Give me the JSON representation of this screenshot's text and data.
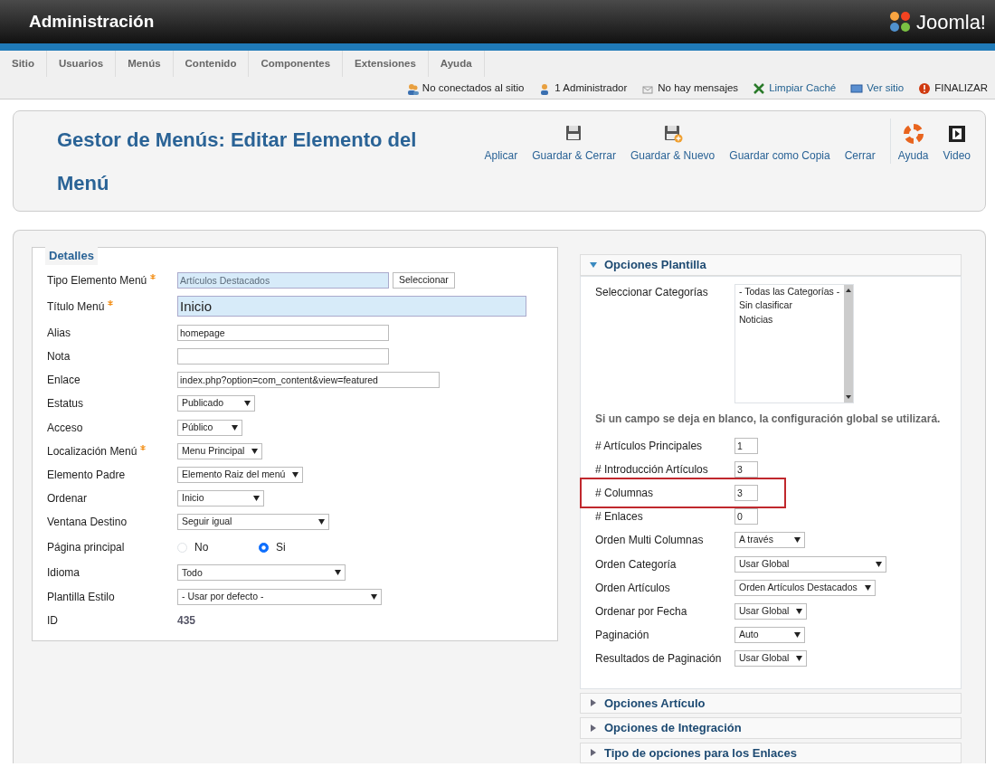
{
  "header": {
    "title": "Administración",
    "logo": "Joomla!"
  },
  "menu": [
    "Sitio",
    "Usuarios",
    "Menús",
    "Contenido",
    "Componentes",
    "Extensiones",
    "Ayuda"
  ],
  "status": [
    {
      "text": "No conectados al sitio",
      "kind": "plain"
    },
    {
      "text": "1 Administrador",
      "kind": "plain"
    },
    {
      "text": "No hay mensajes",
      "kind": "plain"
    },
    {
      "text": "Limpiar Caché",
      "kind": "link"
    },
    {
      "text": "Ver sitio",
      "kind": "link"
    },
    {
      "text": "FINALIZAR",
      "kind": "plain"
    }
  ],
  "toolbar": {
    "title": "Gestor de Menús: Editar Elemento del Menú",
    "buttons": [
      "Aplicar",
      "Guardar & Cerrar",
      "Guardar & Nuevo",
      "Guardar como Copia",
      "Cerrar"
    ],
    "help": [
      "Ayuda",
      "Video"
    ]
  },
  "details": {
    "legend": "Detalles",
    "fields": [
      {
        "kind": "text-button",
        "label": "Tipo Elemento Menú",
        "required": true,
        "value": "Artículos Destacados",
        "button": "Seleccionar"
      },
      {
        "kind": "big-text",
        "label": "Título Menú",
        "required": true,
        "value": "Inicio"
      },
      {
        "kind": "text",
        "label": "Alias",
        "required": false,
        "value": "homepage"
      },
      {
        "kind": "text",
        "label": "Nota",
        "required": false
      },
      {
        "kind": "text",
        "label": "Enlace",
        "required": false,
        "value": "index.php?option=com_content&view=featured"
      },
      {
        "kind": "select",
        "label": "Estatus",
        "required": false,
        "value": "Publicado"
      },
      {
        "kind": "select",
        "label": "Acceso",
        "required": false,
        "value": "Público"
      },
      {
        "kind": "select",
        "label": "Localización Menú",
        "required": true,
        "value": "Menu Principal"
      },
      {
        "kind": "select",
        "label": "Elemento Padre",
        "required": false,
        "value": "Elemento Raiz del menú"
      },
      {
        "kind": "select",
        "label": "Ordenar",
        "required": false,
        "value": "Inicio"
      },
      {
        "kind": "select",
        "label": "Ventana Destino",
        "required": false,
        "value": "Seguir igual"
      },
      {
        "kind": "radio",
        "label": "Página principal",
        "required": false,
        "options": [
          {
            "label": "No",
            "selected": false
          },
          {
            "label": "Si",
            "selected": true
          }
        ]
      },
      {
        "kind": "select",
        "label": "Idioma",
        "required": false,
        "value": "Todo"
      },
      {
        "kind": "select",
        "label": "Plantilla Estilo",
        "required": false,
        "value": "- Usar por defecto -"
      },
      {
        "kind": "static",
        "label": "ID",
        "required": false,
        "value": "435"
      }
    ]
  },
  "panels": [
    {
      "title": "Opciones Plantilla",
      "expanded": true,
      "categories": {
        "label": "Seleccionar Categorías",
        "options": [
          "- Todas las Categorías -",
          "Sin clasificar",
          "Noticias"
        ]
      },
      "note": "Si un campo se deja en blanco, la configuración global se utilizará.",
      "fields": [
        {
          "kind": "number",
          "label": "# Artículos Principales",
          "value": "1",
          "highlighted": false
        },
        {
          "kind": "number",
          "label": "# Introducción Artículos",
          "value": "3",
          "highlighted": false
        },
        {
          "kind": "number",
          "label": "# Columnas",
          "value": "3",
          "highlighted": true
        },
        {
          "kind": "number",
          "label": "# Enlaces",
          "value": "0",
          "highlighted": false
        },
        {
          "kind": "select",
          "label": "Orden Multi Columnas",
          "value": "A través",
          "highlighted": false
        },
        {
          "kind": "select",
          "label": "Orden Categoría",
          "value": "Usar Global",
          "highlighted": false
        },
        {
          "kind": "select",
          "label": "Orden Artículos",
          "value": "Orden Artículos Destacados",
          "highlighted": false
        },
        {
          "kind": "select",
          "label": "Ordenar por Fecha",
          "value": "Usar Global",
          "highlighted": false
        },
        {
          "kind": "select",
          "label": "Paginación",
          "value": "Auto",
          "highlighted": false
        },
        {
          "kind": "select",
          "label": "Resultados de Paginación",
          "value": "Usar Global",
          "highlighted": false
        }
      ]
    },
    {
      "title": "Opciones Artículo",
      "expanded": false
    },
    {
      "title": "Opciones de Integración",
      "expanded": false
    },
    {
      "title": "Tipo de opciones para los Enlaces",
      "expanded": false
    }
  ]
}
